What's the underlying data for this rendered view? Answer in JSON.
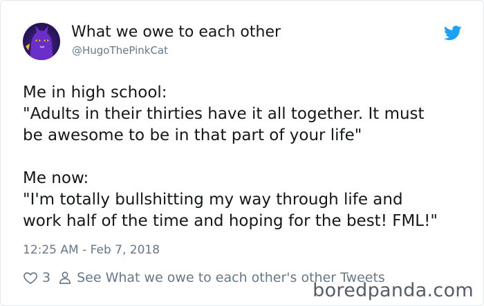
{
  "tweet": {
    "display_name": "What we owe to each other",
    "handle": "@HugoThePinkCat",
    "text_lines": [
      "Me in high school:",
      "\"Adults in their thirties have it all together. It must",
      "be awesome to be in that part of your life\"",
      "",
      "Me now:",
      "\"I'm totally bullshitting my way through life and",
      "work half of the time and hoping for the best! FML!\""
    ],
    "timestamp": "12:25 AM - Feb 7, 2018",
    "like_count": "3",
    "see_more_label": "See What we owe to each other's other Tweets"
  },
  "watermark": "boredpanda.com",
  "icons": {
    "brand": "twitter-bird-icon",
    "like": "heart-icon",
    "profile": "person-icon"
  },
  "colors": {
    "twitter_blue": "#1da1f2",
    "text_primary": "#14171a",
    "text_secondary": "#657786"
  }
}
